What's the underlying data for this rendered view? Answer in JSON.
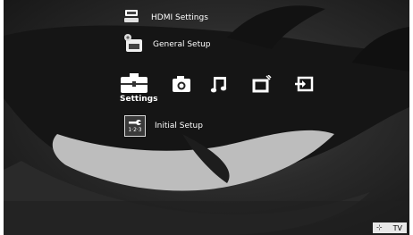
{
  "menu": {
    "items": [
      {
        "label": "HDMI Settings",
        "icon": "hdmi-settings-icon"
      },
      {
        "label": "General Setup",
        "icon": "general-setup-icon"
      }
    ]
  },
  "categories": {
    "selected_label": "Settings",
    "items": [
      {
        "icon": "settings-toolbox-icon"
      },
      {
        "icon": "photo-camera-icon"
      },
      {
        "icon": "music-note-icon"
      },
      {
        "icon": "video-icon"
      },
      {
        "icon": "input-icon"
      }
    ]
  },
  "submenu": {
    "items": [
      {
        "label": "Initial Setup",
        "icon": "initial-setup-icon",
        "icon_text": "1·2·3"
      }
    ]
  },
  "status": {
    "tv_label": "TV",
    "icon": "tv-input-icon"
  }
}
